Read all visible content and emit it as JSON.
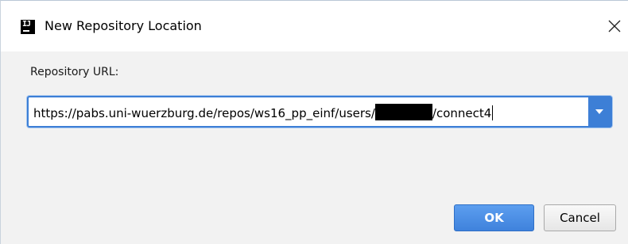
{
  "window": {
    "title": "New Repository Location",
    "app_icon": "intellij-idea-icon",
    "app_icon_text": "IJ"
  },
  "form": {
    "label": "Repository URL:",
    "url_prefix": "https://pabs.uni-wuerzburg.de/repos/ws16_pp_einf/users/",
    "url_suffix": "/connect4"
  },
  "buttons": {
    "ok": "OK",
    "cancel": "Cancel"
  },
  "colors": {
    "accent": "#3d7fd6",
    "ok_button": "#4a8ee6",
    "dialog_background": "#f2f2f2"
  }
}
